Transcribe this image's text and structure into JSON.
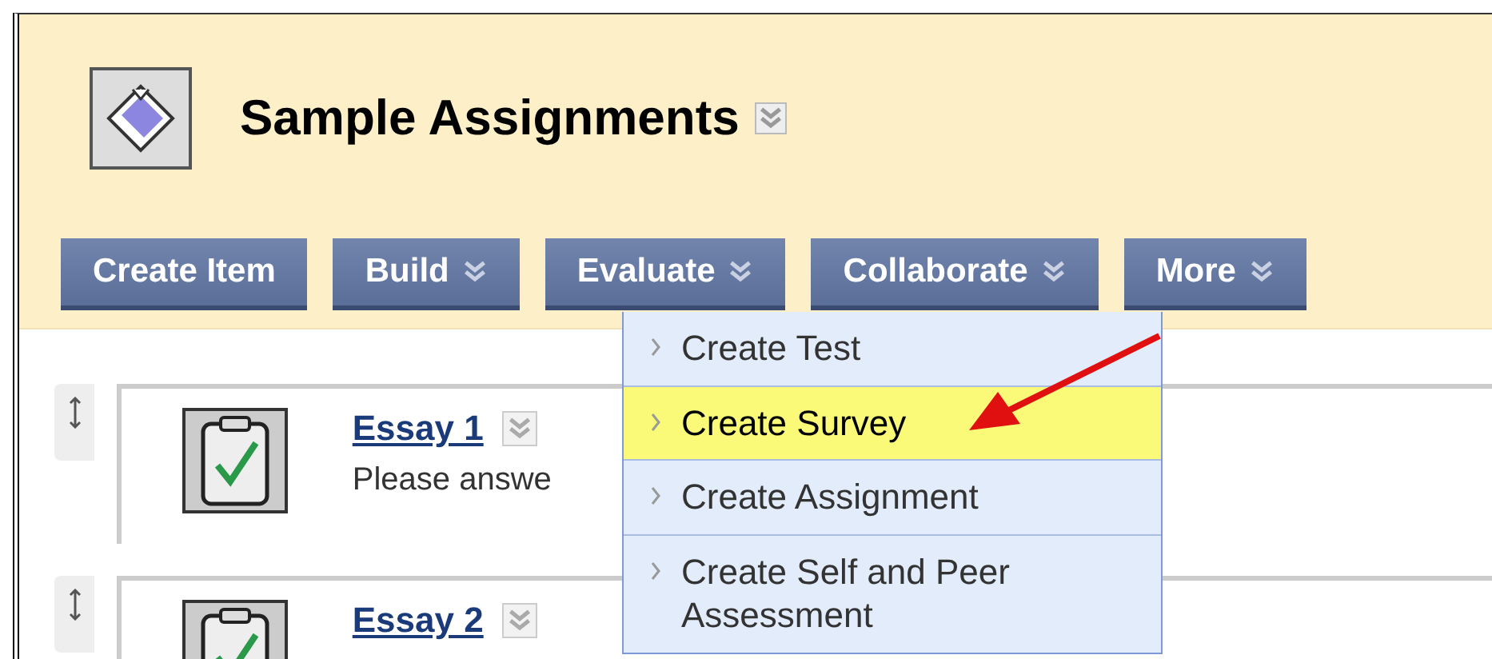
{
  "course": {
    "title": "Sample Assignments"
  },
  "toolbar": [
    {
      "label": "Create Item",
      "has_menu": false
    },
    {
      "label": "Build",
      "has_menu": true
    },
    {
      "label": "Evaluate",
      "has_menu": true
    },
    {
      "label": "Collaborate",
      "has_menu": true
    },
    {
      "label": "More",
      "has_menu": true
    }
  ],
  "menu": {
    "items": [
      {
        "label": "Create Test",
        "selected": false
      },
      {
        "label": "Create Survey",
        "selected": true
      },
      {
        "label": "Create Assignment",
        "selected": false
      },
      {
        "label": "Create Self and Peer Assessment",
        "selected": false
      }
    ]
  },
  "items": [
    {
      "title": "Essay 1",
      "description": "Please answe"
    },
    {
      "title": "Essay 2"
    }
  ]
}
